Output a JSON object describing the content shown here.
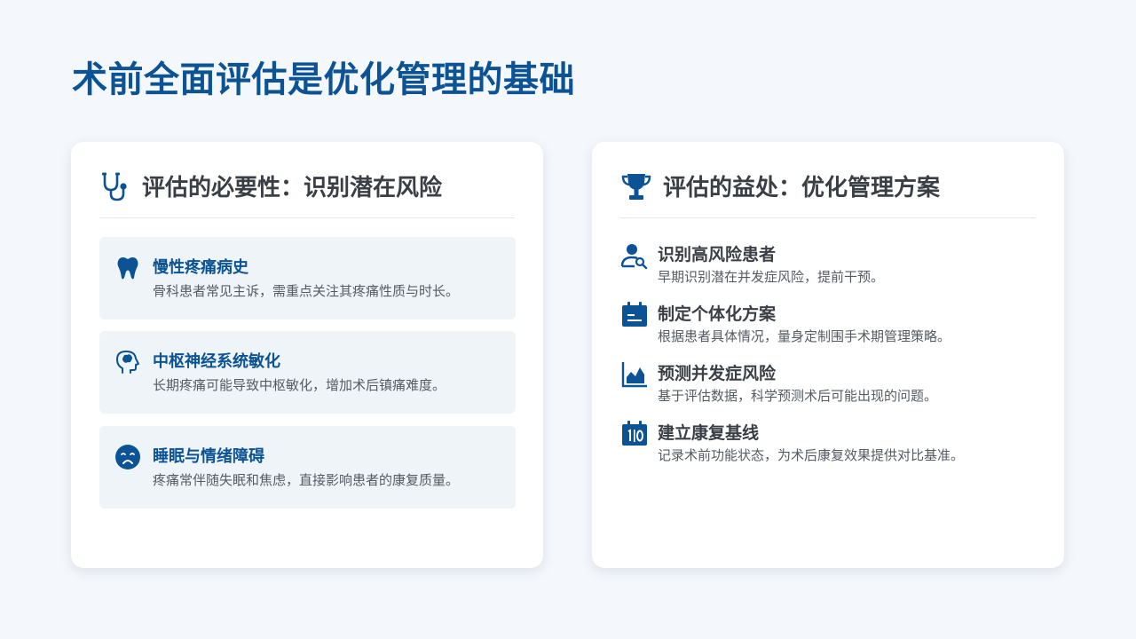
{
  "page": {
    "title": "术前全面评估是优化管理的基础"
  },
  "colors": {
    "brand": "#0b5394",
    "background": "#f4f7fb",
    "card_bg": "#ffffff",
    "item_bg": "#eef4f8",
    "heading_text": "#3a3f46",
    "body_text": "#555b63"
  },
  "necessity": {
    "heading": "评估的必要性：识别潜在风险",
    "heading_icon": "stethoscope-icon",
    "items": [
      {
        "icon": "tooth-icon",
        "title": "慢性疼痛病史",
        "desc": "骨科患者常见主诉，需重点关注其疼痛性质与时长。"
      },
      {
        "icon": "brain-head-icon",
        "title": "中枢神经系统敏化",
        "desc": "长期疼痛可能导致中枢敏化，增加术后镇痛难度。"
      },
      {
        "icon": "sad-face-icon",
        "title": "睡眠与情绪障碍",
        "desc": "疼痛常伴随失眠和焦虑，直接影响患者的康复质量。"
      }
    ]
  },
  "benefits": {
    "heading": "评估的益处：优化管理方案",
    "heading_icon": "trophy-icon",
    "items": [
      {
        "icon": "user-search-icon",
        "title": "识别高风险患者",
        "desc": "早期识别潜在并发症风险，提前干预。"
      },
      {
        "icon": "calendar-icon",
        "title": "制定个体化方案",
        "desc": "根据患者具体情况，量身定制围手术期管理策略。"
      },
      {
        "icon": "area-chart-icon",
        "title": "预测并发症风险",
        "desc": "基于评估数据，科学预测术后可能出现的问题。"
      },
      {
        "icon": "baseline-calendar-icon",
        "title": "建立康复基线",
        "desc": "记录术前功能状态，为术后康复效果提供对比基准。"
      }
    ]
  }
}
